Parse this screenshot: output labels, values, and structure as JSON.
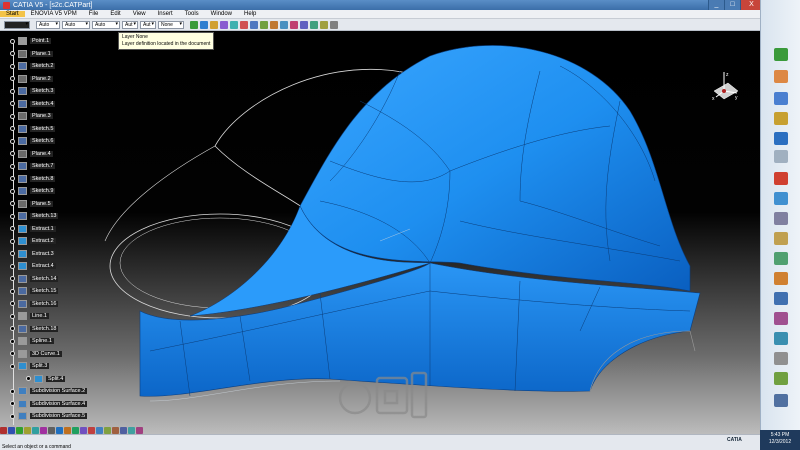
{
  "window": {
    "title": "CATIA V5 - [s2c.CATPart]",
    "buttons": {
      "minimize": "_",
      "maximize": "□",
      "close": "X"
    }
  },
  "menubar": {
    "items": [
      "Start",
      "ENOVIA V5 VPM",
      "File",
      "Edit",
      "View",
      "Insert",
      "Tools",
      "Window",
      "Help"
    ]
  },
  "toolbar": {
    "selects": [
      "Auto",
      "Auto",
      "Auto",
      "Aut",
      "Aut",
      "None"
    ]
  },
  "tooltip": {
    "line1": "Layer None",
    "line2": "Layer definition located in the document"
  },
  "tree": {
    "items": [
      "Point.1",
      "Plane.1",
      "Sketch.2",
      "Plane.2",
      "Sketch.3",
      "Sketch.4",
      "Plane.3",
      "Sketch.5",
      "Sketch.6",
      "Plane.4",
      "Sketch.7",
      "Sketch.8",
      "Sketch.9",
      "Plane.5",
      "Sketch.13",
      "Extract.1",
      "Extract.2",
      "Extract.3",
      "Extract.4",
      "Sketch.14",
      "Sketch.15",
      "Sketch.16",
      "Line.1",
      "Sketch.18",
      "Spline.1",
      "3D Curve.1",
      "Split.3",
      "Split.4",
      "Subdivision Surface.2",
      "Subdivision Surface.4",
      "Subdivision Surface.5"
    ]
  },
  "compass": {
    "x": "x",
    "y": "y",
    "z": "z"
  },
  "status": {
    "prompt": "Select an object or a command"
  },
  "tray": {
    "time": "5:43 PM",
    "date": "12/3/2012"
  },
  "brand": {
    "logo_text": "CATIA"
  },
  "colors": {
    "surface": "#1e8ff0",
    "surface_dark": "#0a5fc0",
    "background_top": "#000000",
    "background_bottom": "#bcbcbc"
  }
}
